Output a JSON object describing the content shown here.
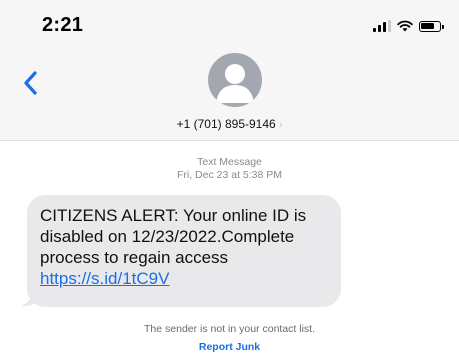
{
  "status_bar": {
    "time": "2:21",
    "icons": [
      "cellular-signal-icon",
      "wifi-icon",
      "battery-icon"
    ]
  },
  "header": {
    "back_icon": "chevron-left-icon",
    "avatar_icon": "person-silhouette-icon",
    "contact_number": "+1 (701) 895-9146",
    "contact_chevron": "›"
  },
  "thread": {
    "message_type": "Text Message",
    "timestamp": "Fri, Dec 23 at 5:38 PM",
    "message": {
      "text_before_link": "CITIZENS ALERT: Your online ID is disabled on 12/23/2022.Complete process to regain access ",
      "link_text": "https://s.id/1tC9V"
    }
  },
  "footer": {
    "not_in_contacts": "The sender is not in your contact list.",
    "report_junk_label": "Report Junk"
  },
  "colors": {
    "header_bg": "#f6f6f6",
    "bubble_bg": "#e9e9eb",
    "link_blue": "#1a6fe8",
    "meta_gray": "#8a8a8e",
    "avatar_gray": "#a3a8b0"
  }
}
